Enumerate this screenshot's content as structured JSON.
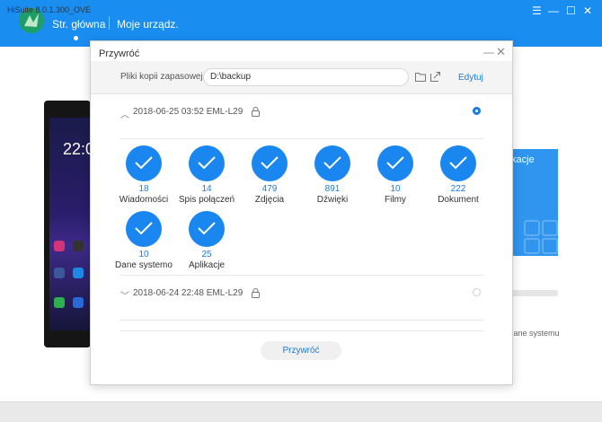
{
  "app": {
    "nav_home": "Str. główna",
    "nav_devices": "Moje urządz.",
    "status_version": "HiSuite 8.0.1.300_OVE",
    "side_card_text": "kacje",
    "side_caption": "cane systemu"
  },
  "phone": {
    "time": "22:0"
  },
  "dialog": {
    "title": "Przywróć",
    "backup_label": "Pliki kopii zapasowej",
    "path": "D:\\backup",
    "edit_label": "Edytuj",
    "restore_button": "Przywróć",
    "records": [
      {
        "date": "2018-06-25 03:52 EML-L29",
        "selected": true,
        "expanded": true
      },
      {
        "date": "2018-06-24 22:48 EML-L29",
        "selected": false,
        "expanded": false
      }
    ],
    "categories": [
      {
        "count": "18",
        "label": "Wiadomości"
      },
      {
        "count": "14",
        "label": "Spis połączeń"
      },
      {
        "count": "479",
        "label": "Zdjęcia"
      },
      {
        "count": "891",
        "label": "Dźwięki"
      },
      {
        "count": "10",
        "label": "Filmy"
      },
      {
        "count": "222",
        "label": "Dokument"
      },
      {
        "count": "10",
        "label": "Dane systemo"
      },
      {
        "count": "25",
        "label": "Aplikacje"
      }
    ]
  },
  "colors": {
    "accent": "#1a86f0",
    "topbar": "#1a8df0"
  }
}
